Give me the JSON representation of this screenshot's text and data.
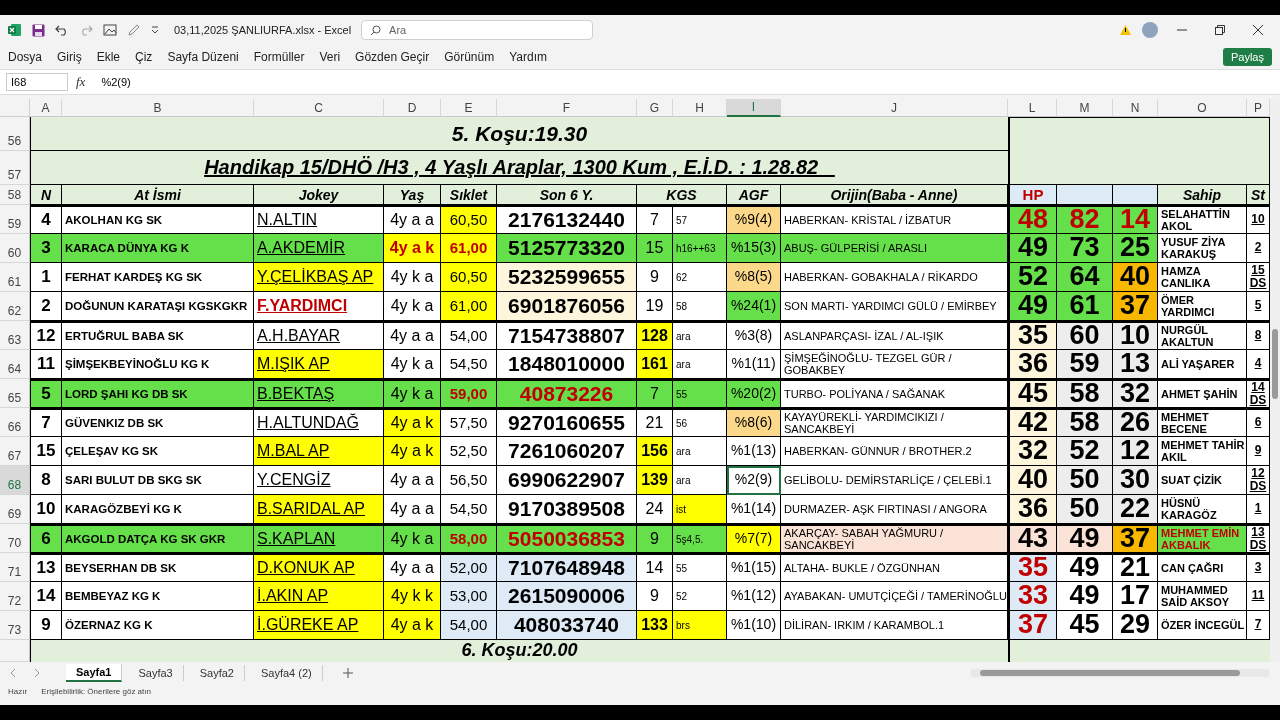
{
  "window": {
    "title": "03,11,2025 ŞANLIURFA.xlsx  -  Excel",
    "search_placeholder": "Ara"
  },
  "menu": [
    "Dosya",
    "Giriş",
    "Ekle",
    "Çiz",
    "Sayfa Düzeni",
    "Formüller",
    "Veri",
    "Gözden Geçir",
    "Görünüm",
    "Yardım"
  ],
  "share_button": "Paylaş",
  "formula_bar": {
    "name_box": "I68",
    "fx": "fx",
    "formula": "%2(9)"
  },
  "columns": [
    {
      "label": "A",
      "selected": false
    },
    {
      "label": "B",
      "selected": false
    },
    {
      "label": "C",
      "selected": false
    },
    {
      "label": "D",
      "selected": false
    },
    {
      "label": "E",
      "selected": false
    },
    {
      "label": "F",
      "selected": false
    },
    {
      "label": "G",
      "selected": false
    },
    {
      "label": "H",
      "selected": false
    },
    {
      "label": "I",
      "selected": true
    },
    {
      "label": "J",
      "selected": false
    },
    {
      "label": "L",
      "selected": false
    },
    {
      "label": "M",
      "selected": false
    },
    {
      "label": "N",
      "selected": false
    },
    {
      "label": "O",
      "selected": false
    },
    {
      "label": "P",
      "selected": false
    }
  ],
  "race_title": {
    "row_number": "56",
    "text": "5. Koşu:19.30"
  },
  "race_subtitle": {
    "row_number": "57",
    "text": "Handikap 15/DHÖ /H3 , 4 Yaşlı Araplar, 1300 Kum , E.İ.D. : 1.28.82   "
  },
  "header_row": {
    "row_number": "58",
    "cells": [
      {
        "text": "N",
        "color": "#e2efda"
      },
      {
        "text": "At İsmi",
        "color": "#e2efda"
      },
      {
        "text": "Jokey",
        "color": "#e2efda"
      },
      {
        "text": "Yaş",
        "color": "#e2efda"
      },
      {
        "text": "Sıklet",
        "color": "#e2efda"
      },
      {
        "text": "Son 6 Y.",
        "color": "#e2efda"
      },
      {
        "text": "KGS",
        "color": "#e2efda"
      },
      {
        "text": "AGF",
        "color": "#e2efda"
      },
      {
        "text": "Orijin(Baba - Anne)",
        "color": "#e2efda"
      },
      {
        "text": "HP",
        "color": "#ddebf7",
        "alert": true
      },
      {
        "color": "#ddebf7"
      },
      {
        "color": "#ddebf7"
      },
      {
        "text": "Sahip",
        "color": "#e2efda"
      },
      {
        "text": "St",
        "color": "#e2efda"
      }
    ]
  },
  "rows": [
    {
      "row_number": "59",
      "selected": false,
      "thick_top": true,
      "cells": [
        {
          "text": "4"
        },
        {
          "text": "AKOLHAN KG SK"
        },
        {
          "text": "N.ALTIN"
        },
        {
          "text": "4y a a"
        },
        {
          "text": "60,50",
          "color": "#ffff00"
        },
        {
          "text": "2176132440"
        },
        {
          "text": "7"
        },
        {
          "text": "57"
        },
        {
          "text": "%9(4)",
          "color": "#fcd88a"
        },
        {
          "text": "HABERKAN- KRİSTAL / İZBATUR"
        },
        {
          "text": "48",
          "color": "#66e04a",
          "alert": true
        },
        {
          "text": "82",
          "color": "#66e04a",
          "alert": true
        },
        {
          "text": "14",
          "color": "#66e04a",
          "alert": true
        },
        {
          "text": "SELAHATTİN AKOL"
        },
        {
          "text": "10"
        }
      ]
    },
    {
      "row_number": "60",
      "selected": false,
      "thick_top": false,
      "cells": [
        {
          "text": "3",
          "color": "#66e04a"
        },
        {
          "text": "KARACA DÜNYA KG K",
          "color": "#66e04a"
        },
        {
          "text": "A.AKDEMİR",
          "color": "#66e04a"
        },
        {
          "text": "4y a k",
          "color": "#ffff00",
          "alert": true
        },
        {
          "text": "61,00",
          "color": "#ffff00",
          "alert": true
        },
        {
          "text": "5125773320",
          "color": "#66e04a"
        },
        {
          "text": "15",
          "color": "#66e04a"
        },
        {
          "text": "h16++63",
          "color": "#66e04a"
        },
        {
          "text": "%15(3)",
          "color": "#66e04a"
        },
        {
          "text": "ABUŞ- GÜLPERİSİ / ARASLI",
          "color": "#66e04a"
        },
        {
          "text": "49",
          "color": "#66e04a"
        },
        {
          "text": "73",
          "color": "#66e04a"
        },
        {
          "text": "25",
          "color": "#66e04a"
        },
        {
          "text": "YUSUF ZİYA KARAKUŞ"
        },
        {
          "text": "2"
        }
      ]
    },
    {
      "row_number": "61",
      "selected": false,
      "thick_top": false,
      "cells": [
        {
          "text": "1"
        },
        {
          "text": "FERHAT KARDEŞ KG SK"
        },
        {
          "text": "Y.ÇELİKBAŞ AP",
          "color": "#ffff00"
        },
        {
          "text": "4y k a"
        },
        {
          "text": "60,50",
          "color": "#ffff00"
        },
        {
          "text": "5232599655",
          "color": "#fdf5dc"
        },
        {
          "text": "9"
        },
        {
          "text": "62"
        },
        {
          "text": "%8(5)",
          "color": "#fcd88a"
        },
        {
          "text": "HABERKAN- GOBAKHALA / RİKARDO"
        },
        {
          "text": "52",
          "color": "#66e04a"
        },
        {
          "text": "64",
          "color": "#66e04a"
        },
        {
          "text": "40",
          "color": "#f8b800"
        },
        {
          "text": "HAMZA CANLIKA"
        },
        {
          "text": "15 DS"
        }
      ]
    },
    {
      "row_number": "62",
      "selected": false,
      "thick_top": false,
      "cells": [
        {
          "text": "2"
        },
        {
          "text": "DOĞUNUN KARATAŞI KGSKGKR"
        },
        {
          "text": "F.YARDIMCI",
          "alert": true
        },
        {
          "text": "4y k a"
        },
        {
          "text": "61,00",
          "color": "#ffff00"
        },
        {
          "text": "6901876056",
          "color": "#fdf5dc"
        },
        {
          "text": "19"
        },
        {
          "text": "58"
        },
        {
          "text": "%24(1)",
          "color": "#66e04a"
        },
        {
          "text": "SON MARTI- YARDIMCI GÜLÜ / EMİRBEY"
        },
        {
          "text": "49",
          "color": "#66e04a"
        },
        {
          "text": "61",
          "color": "#66e04a"
        },
        {
          "text": "37",
          "color": "#f8b800"
        },
        {
          "text": "ÖMER YARDIMCI"
        },
        {
          "text": "5"
        }
      ]
    },
    {
      "row_number": "63",
      "selected": false,
      "thick_top": true,
      "cells": [
        {
          "text": "12"
        },
        {
          "text": "ERTUĞRUL BABA SK"
        },
        {
          "text": "A.H.BAYAR"
        },
        {
          "text": "4y a a"
        },
        {
          "text": "54,00"
        },
        {
          "text": "7154738807"
        },
        {
          "text": "128",
          "color": "#ffff00",
          "strong": true
        },
        {
          "text": "ara"
        },
        {
          "text": "%3(8)"
        },
        {
          "text": "ASLANPARÇASI- İZAL / AL-IŞIK"
        },
        {
          "text": "35",
          "color": "#fdf5dc"
        },
        {
          "text": "60",
          "color": "#ededed"
        },
        {
          "text": "10",
          "color": "#ededed"
        },
        {
          "text": "NURGÜL AKALTUN"
        },
        {
          "text": "8"
        }
      ]
    },
    {
      "row_number": "64",
      "selected": false,
      "thick_top": false,
      "cells": [
        {
          "text": "11"
        },
        {
          "text": "ŞİMŞEKBEYİNOĞLU KG K"
        },
        {
          "text": "M.IŞIK AP",
          "color": "#ffff00"
        },
        {
          "text": "4y k a"
        },
        {
          "text": "54,50"
        },
        {
          "text": "1848010000"
        },
        {
          "text": "161",
          "color": "#ffff00",
          "strong": true
        },
        {
          "text": "ara"
        },
        {
          "text": "%1(11)"
        },
        {
          "text": "ŞİMŞEĞİNOĞLU- TEZGEL GÜR / GOBAKBEY"
        },
        {
          "text": "36",
          "color": "#fdf5dc"
        },
        {
          "text": "59",
          "color": "#ededed"
        },
        {
          "text": "13",
          "color": "#ededed"
        },
        {
          "text": "ALİ YAŞARER"
        },
        {
          "text": "4"
        }
      ]
    },
    {
      "row_number": "65",
      "selected": false,
      "thick_top": true,
      "cells": [
        {
          "text": "5",
          "color": "#66e04a"
        },
        {
          "text": "LORD ŞAHI KG DB SK",
          "color": "#66e04a"
        },
        {
          "text": "B.BEKTAŞ",
          "color": "#66e04a"
        },
        {
          "text": "4y k a",
          "color": "#66e04a"
        },
        {
          "text": "59,00",
          "color": "#66e04a",
          "alert": true
        },
        {
          "text": "40873226",
          "color": "#66e04a",
          "alert": true
        },
        {
          "text": "7",
          "color": "#66e04a"
        },
        {
          "text": "55",
          "color": "#66e04a"
        },
        {
          "text": "%20(2)",
          "color": "#66e04a"
        },
        {
          "text": "TURBO- POLİYANA / SAĞANAK"
        },
        {
          "text": "45",
          "color": "#fdf5dc"
        },
        {
          "text": "58",
          "color": "#ededed"
        },
        {
          "text": "32",
          "color": "#ededed"
        },
        {
          "text": "AHMET ŞAHİN"
        },
        {
          "text": "14 DS"
        }
      ]
    },
    {
      "row_number": "66",
      "selected": false,
      "thick_top": true,
      "cells": [
        {
          "text": "7"
        },
        {
          "text": "GÜVENKIZ DB SK"
        },
        {
          "text": "H.ALTUNDAĞ"
        },
        {
          "text": "4y a k",
          "color": "#ffff00"
        },
        {
          "text": "57,50"
        },
        {
          "text": "9270160655"
        },
        {
          "text": "21"
        },
        {
          "text": "56"
        },
        {
          "text": "%8(6)",
          "color": "#fcd88a"
        },
        {
          "text": "KAYAYÜREKLİ- YARDIMCIKIZI / SANCAKBEYİ"
        },
        {
          "text": "42",
          "color": "#fdf5dc"
        },
        {
          "text": "58",
          "color": "#ededed"
        },
        {
          "text": "26",
          "color": "#ededed"
        },
        {
          "text": "MEHMET BECENE"
        },
        {
          "text": "6"
        }
      ]
    },
    {
      "row_number": "67",
      "selected": false,
      "thick_top": false,
      "cells": [
        {
          "text": "15"
        },
        {
          "text": "ÇELEŞAV KG SK"
        },
        {
          "text": "M.BAL AP",
          "color": "#ffff00"
        },
        {
          "text": "4y a k",
          "color": "#ffff00"
        },
        {
          "text": "52,50"
        },
        {
          "text": "7261060207"
        },
        {
          "text": "156",
          "color": "#ffff00",
          "strong": true
        },
        {
          "text": "ara"
        },
        {
          "text": "%1(13)"
        },
        {
          "text": "HABERKAN- GÜNNUR / BROTHER.2"
        },
        {
          "text": "32",
          "color": "#fdf5dc"
        },
        {
          "text": "52",
          "color": "#ededed"
        },
        {
          "text": "12",
          "color": "#ededed"
        },
        {
          "text": "MEHMET TAHİR AKIL"
        },
        {
          "text": "9"
        }
      ]
    },
    {
      "row_number": "68",
      "selected": true,
      "thick_top": false,
      "cells": [
        {
          "text": "8"
        },
        {
          "text": "SARI BULUT DB SKG SK"
        },
        {
          "text": "Y.CENGİZ"
        },
        {
          "text": "4y a a"
        },
        {
          "text": "56,50"
        },
        {
          "text": "6990622907"
        },
        {
          "text": "139",
          "color": "#ffff00",
          "strong": true
        },
        {
          "text": "ara"
        },
        {
          "text": "%2(9)",
          "selected": true
        },
        {
          "text": "GELİBOLU- DEMİRSTARLİÇE / ÇELEBİ.1"
        },
        {
          "text": "40",
          "color": "#fdf5dc"
        },
        {
          "text": "50",
          "color": "#ededed"
        },
        {
          "text": "30",
          "color": "#ededed"
        },
        {
          "text": "SUAT ÇİZİK"
        },
        {
          "text": "12 DS"
        }
      ]
    },
    {
      "row_number": "69",
      "selected": false,
      "thick_top": false,
      "cells": [
        {
          "text": "10"
        },
        {
          "text": "KARAGÖZBEYİ KG K"
        },
        {
          "text": "B.SARIDAL AP",
          "color": "#ffff00"
        },
        {
          "text": "4y a a"
        },
        {
          "text": "54,50"
        },
        {
          "text": "9170389508"
        },
        {
          "text": "24"
        },
        {
          "text": "ist",
          "color": "#ffff00"
        },
        {
          "text": "%1(14)"
        },
        {
          "text": "DURMAZER- AŞK FIRTINASI / ANGORA"
        },
        {
          "text": "36",
          "color": "#fdf5dc"
        },
        {
          "text": "50",
          "color": "#ededed"
        },
        {
          "text": "22",
          "color": "#ededed"
        },
        {
          "text": "HÜSNÜ KARAGÖZ"
        },
        {
          "text": "1"
        }
      ]
    },
    {
      "row_number": "70",
      "selected": false,
      "thick_top": true,
      "cells": [
        {
          "text": "6",
          "color": "#66e04a"
        },
        {
          "text": "AKGOLD DATÇA KG SK GKR",
          "color": "#66e04a"
        },
        {
          "text": "S.KAPLAN",
          "color": "#66e04a"
        },
        {
          "text": "4y k a",
          "color": "#66e04a"
        },
        {
          "text": "58,00",
          "color": "#66e04a",
          "alert": true
        },
        {
          "text": "5050036853",
          "color": "#66e04a",
          "alert": true
        },
        {
          "text": "9",
          "color": "#66e04a"
        },
        {
          "text": "5ş4,5.",
          "color": "#66e04a"
        },
        {
          "text": "%7(7)",
          "color": "#ffff00"
        },
        {
          "text": "AKARÇAY- SABAH YAĞMURU / SANCAKBEYİ",
          "color": "#fbe2d6"
        },
        {
          "text": "43",
          "color": "#fbe2d6"
        },
        {
          "text": "49",
          "color": "#fbe2d6"
        },
        {
          "text": "37",
          "color": "#f8b800"
        },
        {
          "text": "MEHMET EMİN AKBALIK",
          "color": "#66e04a",
          "alert": true
        },
        {
          "text": "13 DS"
        }
      ]
    },
    {
      "row_number": "71",
      "selected": false,
      "thick_top": true,
      "cells": [
        {
          "text": "13"
        },
        {
          "text": "BEYSERHAN DB SK"
        },
        {
          "text": "D.KONUK AP",
          "color": "#ffff00"
        },
        {
          "text": "4y a a"
        },
        {
          "text": "52,00",
          "color": "#deeaf6"
        },
        {
          "text": "7107648948",
          "color": "#deeaf6"
        },
        {
          "text": "14"
        },
        {
          "text": "55"
        },
        {
          "text": "%1(15)"
        },
        {
          "text": "ALTAHA- BUKLE / ÖZGÜNHAN"
        },
        {
          "text": "35",
          "color": "#deeaf6",
          "alert": true
        },
        {
          "text": "49"
        },
        {
          "text": "21"
        },
        {
          "text": "CAN ÇAĞRI"
        },
        {
          "text": "3"
        }
      ]
    },
    {
      "row_number": "72",
      "selected": false,
      "thick_top": false,
      "cells": [
        {
          "text": "14"
        },
        {
          "text": "BEMBEYAZ KG K"
        },
        {
          "text": "İ.AKIN AP",
          "color": "#ffff00"
        },
        {
          "text": "4y k k",
          "color": "#ffff00"
        },
        {
          "text": "53,00",
          "color": "#deeaf6"
        },
        {
          "text": "2615090006",
          "color": "#deeaf6"
        },
        {
          "text": "9"
        },
        {
          "text": "52"
        },
        {
          "text": "%1(12)"
        },
        {
          "text": "AYABAKAN- UMUTÇİÇEĞİ / TAMERİNOĞLU"
        },
        {
          "text": "33",
          "color": "#deeaf6",
          "alert": true
        },
        {
          "text": "49"
        },
        {
          "text": "17"
        },
        {
          "text": "MUHAMMED SAİD AKSOY"
        },
        {
          "text": "11"
        }
      ]
    },
    {
      "row_number": "73",
      "selected": false,
      "thick_top": false,
      "cells": [
        {
          "text": "9"
        },
        {
          "text": "ÖZERNAZ KG K"
        },
        {
          "text": "İ.GÜREKE AP",
          "color": "#ffff00"
        },
        {
          "text": "4y a k",
          "color": "#ffff00"
        },
        {
          "text": "54,00",
          "color": "#deeaf6"
        },
        {
          "text": "408033740",
          "color": "#deeaf6"
        },
        {
          "text": "133",
          "color": "#ffff00",
          "strong": true
        },
        {
          "text": "brs",
          "color": "#ffff00"
        },
        {
          "text": "%1(10)"
        },
        {
          "text": "DİLİRAN- IRKIM / KARAMBOL.1"
        },
        {
          "text": "37",
          "color": "#deeaf6",
          "alert": true
        },
        {
          "text": "45"
        },
        {
          "text": "29"
        },
        {
          "text": "ÖZER İNCEGÜL"
        },
        {
          "text": "7"
        }
      ]
    }
  ],
  "next_race_title": {
    "text": "6. Koşu:20.00"
  },
  "sheet_tabs": [
    {
      "label": "Sayfa1",
      "selected": true
    },
    {
      "label": "Sayfa3",
      "selected": false
    },
    {
      "label": "Sayfa2",
      "selected": false
    },
    {
      "label": "Sayfa4 (2)",
      "selected": false
    }
  ],
  "status_bar": {
    "state": "Hazır",
    "accessibility": "Erişilebilirlik: Önerilere göz atın"
  }
}
